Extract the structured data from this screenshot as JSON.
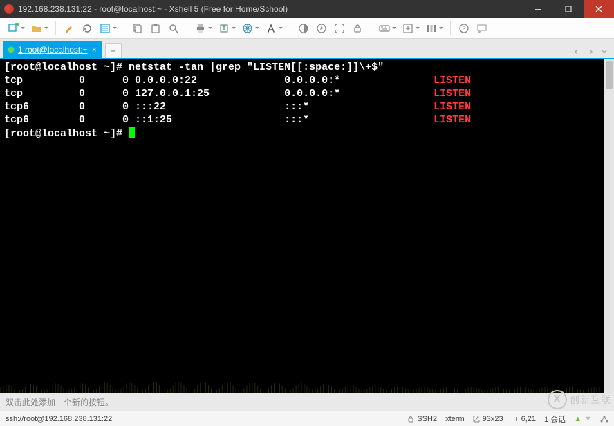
{
  "titlebar": {
    "title": "192.168.238.131:22 - root@localhost:~ - Xshell 5 (Free for Home/School)"
  },
  "toolbar": {
    "items": [
      {
        "name": "new-session-icon",
        "dd": true
      },
      {
        "name": "open-icon",
        "dd": true
      },
      {
        "name": "highlight-icon",
        "dd": false
      },
      {
        "name": "reconnect-icon",
        "dd": false
      },
      {
        "name": "properties-icon",
        "dd": true
      },
      {
        "name": "copy-icon",
        "dd": false
      },
      {
        "name": "paste-icon",
        "dd": false
      },
      {
        "name": "find-icon",
        "dd": false
      },
      {
        "name": "print-icon",
        "dd": true
      },
      {
        "name": "file-transfer-icon",
        "dd": true
      },
      {
        "name": "globe-icon",
        "dd": true
      },
      {
        "name": "font-icon",
        "dd": true
      },
      {
        "name": "color-scheme-icon",
        "dd": false
      },
      {
        "name": "compass-icon",
        "dd": false
      },
      {
        "name": "fullscreen-icon",
        "dd": false
      },
      {
        "name": "lock-toolbar-icon",
        "dd": false
      },
      {
        "name": "keyboard-icon",
        "dd": true
      },
      {
        "name": "add-button-icon",
        "dd": true
      },
      {
        "name": "columns-icon",
        "dd": true
      },
      {
        "name": "help-icon",
        "dd": false
      },
      {
        "name": "feedback-icon",
        "dd": false
      }
    ]
  },
  "tabs": {
    "active_label": "1 root@localhost:~"
  },
  "terminal": {
    "prompt": "[root@localhost ~]# ",
    "command": "netstat -tan |grep \"LISTEN[[:space:]]\\+$\"",
    "rows": [
      {
        "proto": "tcp",
        "recvq": "0",
        "sendq": "0",
        "local": "0.0.0.0:22",
        "remote": "0.0.0.0:*",
        "state": "LISTEN"
      },
      {
        "proto": "tcp",
        "recvq": "0",
        "sendq": "0",
        "local": "127.0.0.1:25",
        "remote": "0.0.0.0:*",
        "state": "LISTEN"
      },
      {
        "proto": "tcp6",
        "recvq": "0",
        "sendq": "0",
        "local": ":::22",
        "remote": ":::*",
        "state": "LISTEN"
      },
      {
        "proto": "tcp6",
        "recvq": "0",
        "sendq": "0",
        "local": "::1:25",
        "remote": ":::*",
        "state": "LISTEN"
      }
    ],
    "prompt2": "[root@localhost ~]# "
  },
  "hintbar": {
    "text": "双击此处添加一个新的按钮。"
  },
  "statusbar": {
    "url": "ssh://root@192.168.238.131:22",
    "protocol": "SSH2",
    "term": "xterm",
    "size": "93x23",
    "cursor": "6,21",
    "sessions_label": "1 会话"
  },
  "watermark": {
    "text": "创新互联"
  }
}
